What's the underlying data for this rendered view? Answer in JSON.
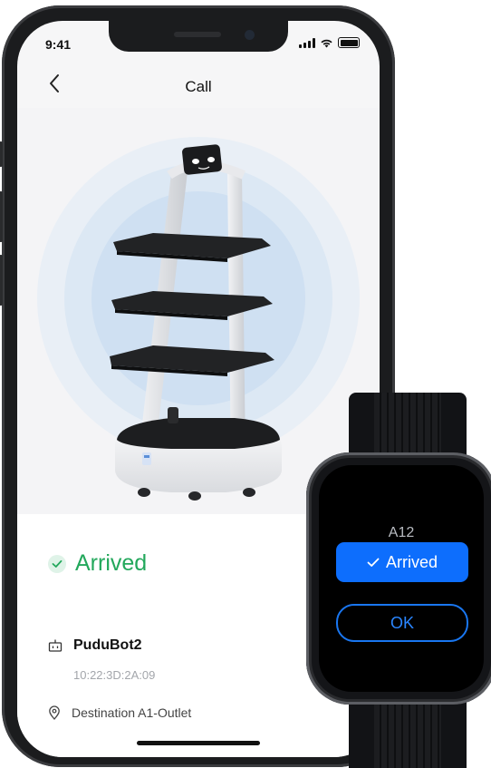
{
  "status_bar": {
    "time": "9:41"
  },
  "header": {
    "title": "Call",
    "back_icon": "chevron-left-icon"
  },
  "delivery": {
    "status": "Arrived",
    "status_color": "#23a85c",
    "robot_name": "PuduBot2",
    "robot_id": "10:22:3D:2A:09",
    "destination": "Destination A1-Outlet"
  },
  "watch": {
    "table": "A12",
    "arrived_label": "Arrived",
    "ok_label": "OK",
    "accent": "#0d6efd"
  }
}
